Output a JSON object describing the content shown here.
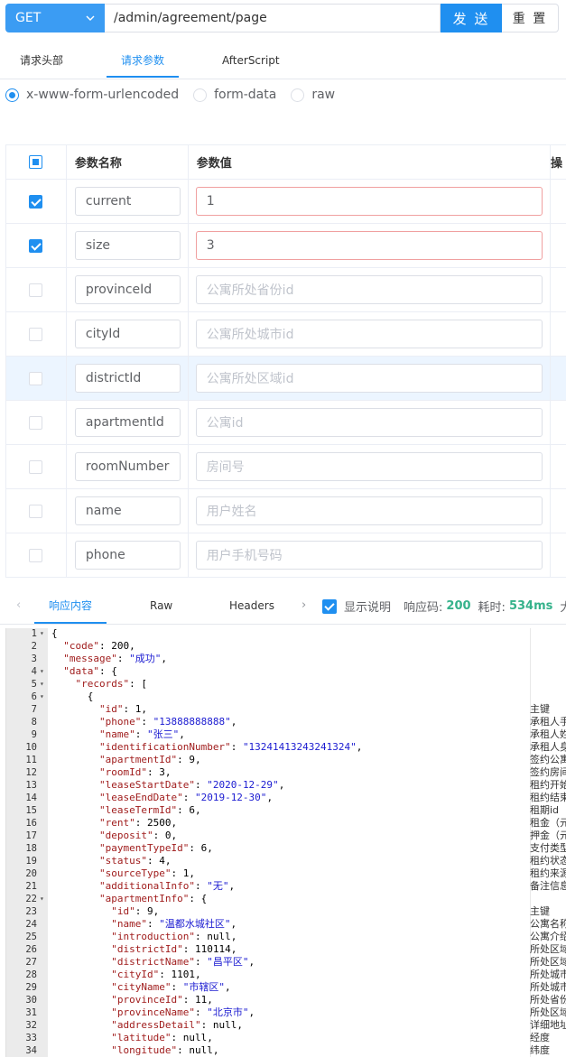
{
  "request": {
    "method": "GET",
    "url": "/admin/agreement/page",
    "send_label": "发 送",
    "reset_label": "重 置"
  },
  "tabs": [
    "请求头部",
    "请求参数",
    "AfterScript"
  ],
  "body_types": [
    "x-www-form-urlencoded",
    "form-data",
    "raw"
  ],
  "params": {
    "headers": {
      "name": "参数名称",
      "value": "参数值",
      "op": "操"
    },
    "rows": [
      {
        "checked": true,
        "name": "current",
        "value": "1",
        "placeholder": ""
      },
      {
        "checked": true,
        "name": "size",
        "value": "3",
        "placeholder": ""
      },
      {
        "checked": false,
        "name": "provinceId",
        "value": "",
        "placeholder": "公寓所处省份id"
      },
      {
        "checked": false,
        "name": "cityId",
        "value": "",
        "placeholder": "公寓所处城市id"
      },
      {
        "checked": false,
        "name": "districtId",
        "value": "",
        "placeholder": "公寓所处区域id"
      },
      {
        "checked": false,
        "name": "apartmentId",
        "value": "",
        "placeholder": "公寓id"
      },
      {
        "checked": false,
        "name": "roomNumber",
        "value": "",
        "placeholder": "房间号"
      },
      {
        "checked": false,
        "name": "name",
        "value": "",
        "placeholder": "用户姓名"
      },
      {
        "checked": false,
        "name": "phone",
        "value": "",
        "placeholder": "用户手机号码"
      }
    ]
  },
  "response": {
    "tabs": [
      "响应内容",
      "Raw",
      "Headers"
    ],
    "show_desc_label": "显示说明",
    "status_label": "响应码:",
    "status_value": "200",
    "time_label": "耗时:",
    "time_value": "534ms",
    "size_label": "大小"
  },
  "code_lines": [
    {
      "n": "1",
      "fold": true,
      "t": "{",
      "c": ""
    },
    {
      "n": "2",
      "fold": false,
      "t": "  \"code\": 200,",
      "c": ""
    },
    {
      "n": "3",
      "fold": false,
      "t": "  \"message\": \"成功\",",
      "c": ""
    },
    {
      "n": "4",
      "fold": true,
      "t": "  \"data\": {",
      "c": ""
    },
    {
      "n": "5",
      "fold": true,
      "t": "    \"records\": [",
      "c": ""
    },
    {
      "n": "6",
      "fold": true,
      "t": "      {",
      "c": ""
    },
    {
      "n": "7",
      "fold": false,
      "t": "        \"id\": 1,",
      "c": "主键"
    },
    {
      "n": "8",
      "fold": false,
      "t": "        \"phone\": \"13888888888\",",
      "c": "承租人手"
    },
    {
      "n": "9",
      "fold": false,
      "t": "        \"name\": \"张三\",",
      "c": "承租人姓"
    },
    {
      "n": "10",
      "fold": false,
      "t": "        \"identificationNumber\": \"13241413243241324\",",
      "c": "承租人身"
    },
    {
      "n": "11",
      "fold": false,
      "t": "        \"apartmentId\": 9,",
      "c": "签约公寓"
    },
    {
      "n": "12",
      "fold": false,
      "t": "        \"roomId\": 3,",
      "c": "签约房间"
    },
    {
      "n": "13",
      "fold": false,
      "t": "        \"leaseStartDate\": \"2020-12-29\",",
      "c": "租约开始"
    },
    {
      "n": "14",
      "fold": false,
      "t": "        \"leaseEndDate\": \"2019-12-30\",",
      "c": "租约结束"
    },
    {
      "n": "15",
      "fold": false,
      "t": "        \"leaseTermId\": 6,",
      "c": "租期id"
    },
    {
      "n": "16",
      "fold": false,
      "t": "        \"rent\": 2500,",
      "c": "租金（元"
    },
    {
      "n": "17",
      "fold": false,
      "t": "        \"deposit\": 0,",
      "c": "押金（元"
    },
    {
      "n": "18",
      "fold": false,
      "t": "        \"paymentTypeId\": 6,",
      "c": "支付类型"
    },
    {
      "n": "19",
      "fold": false,
      "t": "        \"status\": 4,",
      "c": "租约状态"
    },
    {
      "n": "20",
      "fold": false,
      "t": "        \"sourceType\": 1,",
      "c": "租约来源"
    },
    {
      "n": "21",
      "fold": false,
      "t": "        \"additionalInfo\": \"无\",",
      "c": "备注信息"
    },
    {
      "n": "22",
      "fold": true,
      "t": "        \"apartmentInfo\": {",
      "c": ""
    },
    {
      "n": "23",
      "fold": false,
      "t": "          \"id\": 9,",
      "c": "主键"
    },
    {
      "n": "24",
      "fold": false,
      "t": "          \"name\": \"温都水城社区\",",
      "c": "公寓名称"
    },
    {
      "n": "25",
      "fold": false,
      "t": "          \"introduction\": null,",
      "c": "公寓介绍"
    },
    {
      "n": "26",
      "fold": false,
      "t": "          \"districtId\": 110114,",
      "c": "所处区域"
    },
    {
      "n": "27",
      "fold": false,
      "t": "          \"districtName\": \"昌平区\",",
      "c": "所处区域"
    },
    {
      "n": "28",
      "fold": false,
      "t": "          \"cityId\": 1101,",
      "c": "所处城市"
    },
    {
      "n": "29",
      "fold": false,
      "t": "          \"cityName\": \"市辖区\",",
      "c": "所处城市"
    },
    {
      "n": "30",
      "fold": false,
      "t": "          \"provinceId\": 11,",
      "c": "所处省份"
    },
    {
      "n": "31",
      "fold": false,
      "t": "          \"provinceName\": \"北京市\",",
      "c": "所处区域"
    },
    {
      "n": "32",
      "fold": false,
      "t": "          \"addressDetail\": null,",
      "c": "详细地址"
    },
    {
      "n": "33",
      "fold": false,
      "t": "          \"latitude\": null,",
      "c": "经度"
    },
    {
      "n": "34",
      "fold": false,
      "t": "          \"longitude\": null,",
      "c": "纬度"
    }
  ]
}
